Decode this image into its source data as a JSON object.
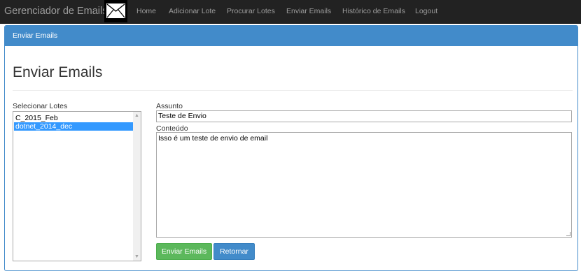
{
  "navbar": {
    "brand": "Gerenciador de Emails",
    "links": [
      "Home",
      "Adicionar Lote",
      "Procurar Lotes",
      "Enviar Emails",
      "Histórico de Emails",
      "Logout"
    ]
  },
  "panel": {
    "heading": "Enviar Emails"
  },
  "page": {
    "title": "Enviar Emails"
  },
  "form": {
    "lotes_label": "Selecionar Lotes",
    "lotes_options": [
      "C_2015_Feb",
      "dotnet_2014_dec"
    ],
    "lotes_selected": "dotnet_2014_dec",
    "assunto_label": "Assunto",
    "assunto_value": "Teste de Envio",
    "conteudo_label": "Conteúdo",
    "conteudo_value": "Isso é um teste de envio de email"
  },
  "buttons": {
    "send": "Enviar Emails",
    "back": "Retornar"
  },
  "colors": {
    "navbar": "#222222",
    "primary": "#428bca",
    "success": "#5cb85c",
    "selection": "#3399ff"
  },
  "icons": {
    "logo": "envelope-icon"
  }
}
